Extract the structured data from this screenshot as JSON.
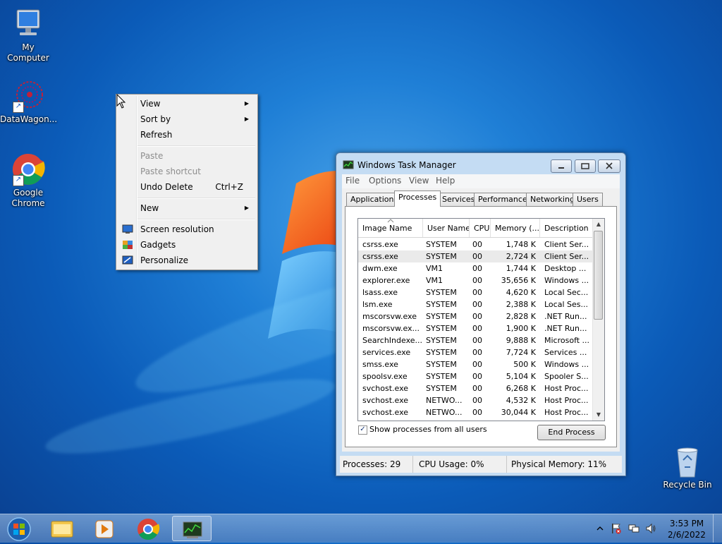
{
  "desktop": {
    "icons": [
      {
        "label": "My Computer"
      },
      {
        "label": "DataWagon..."
      },
      {
        "label": "Google Chrome"
      },
      {
        "label": "Recycle Bin"
      }
    ]
  },
  "context_menu": {
    "items": [
      {
        "label": "View",
        "submenu": true
      },
      {
        "label": "Sort by",
        "submenu": true
      },
      {
        "label": "Refresh"
      },
      {
        "label": "Paste",
        "disabled": true
      },
      {
        "label": "Paste shortcut",
        "disabled": true
      },
      {
        "label": "Undo Delete",
        "shortcut": "Ctrl+Z"
      },
      {
        "label": "New",
        "submenu": true
      },
      {
        "label": "Screen resolution",
        "icon": "display-icon"
      },
      {
        "label": "Gadgets",
        "icon": "gadgets-icon"
      },
      {
        "label": "Personalize",
        "icon": "personalize-icon"
      }
    ]
  },
  "task_manager": {
    "title": "Windows Task Manager",
    "menu": [
      "File",
      "Options",
      "View",
      "Help"
    ],
    "tabs": [
      "Applications",
      "Processes",
      "Services",
      "Performance",
      "Networking",
      "Users"
    ],
    "active_tab": "Processes",
    "columns": [
      "Image Name",
      "User Name",
      "CPU",
      "Memory (...",
      "Description"
    ],
    "rows": [
      [
        "csrss.exe",
        "SYSTEM",
        "00",
        "1,748 K",
        "Client Ser..."
      ],
      [
        "csrss.exe",
        "SYSTEM",
        "00",
        "2,724 K",
        "Client Ser..."
      ],
      [
        "dwm.exe",
        "VM1",
        "00",
        "1,744 K",
        "Desktop ..."
      ],
      [
        "explorer.exe",
        "VM1",
        "00",
        "35,656 K",
        "Windows ..."
      ],
      [
        "lsass.exe",
        "SYSTEM",
        "00",
        "4,620 K",
        "Local Sec..."
      ],
      [
        "lsm.exe",
        "SYSTEM",
        "00",
        "2,388 K",
        "Local Ses..."
      ],
      [
        "mscorsvw.exe",
        "SYSTEM",
        "00",
        "2,828 K",
        ".NET Run..."
      ],
      [
        "mscorsvw.ex...",
        "SYSTEM",
        "00",
        "1,900 K",
        ".NET Run..."
      ],
      [
        "SearchIndexe...",
        "SYSTEM",
        "00",
        "9,888 K",
        "Microsoft ..."
      ],
      [
        "services.exe",
        "SYSTEM",
        "00",
        "7,724 K",
        "Services ..."
      ],
      [
        "smss.exe",
        "SYSTEM",
        "00",
        "500 K",
        "Windows ..."
      ],
      [
        "spoolsv.exe",
        "SYSTEM",
        "00",
        "5,104 K",
        "Spooler S..."
      ],
      [
        "svchost.exe",
        "SYSTEM",
        "00",
        "6,268 K",
        "Host Proc..."
      ],
      [
        "svchost.exe",
        "NETWO...",
        "00",
        "4,532 K",
        "Host Proc..."
      ],
      [
        "svchost.exe",
        "NETWO...",
        "00",
        "30,044 K",
        "Host Proc..."
      ]
    ],
    "selected_row": 1,
    "show_all_label": "Show processes from all users",
    "show_all_checked": "✓",
    "end_process_label": "End Process",
    "status": {
      "processes": "Processes: 29",
      "cpu": "CPU Usage: 0%",
      "memory": "Physical Memory: 11%"
    }
  },
  "taskbar": {
    "time": "3:53 PM",
    "date": "2/6/2022",
    "apps": [
      "start-orb-icon",
      "explorer-icon",
      "media-player-icon",
      "chrome-icon",
      "task-manager-icon"
    ]
  },
  "colors": {
    "desktop_blue": "#0b5bb8",
    "window_frame": "#c4dcf3",
    "selection": "#eaeaea"
  }
}
